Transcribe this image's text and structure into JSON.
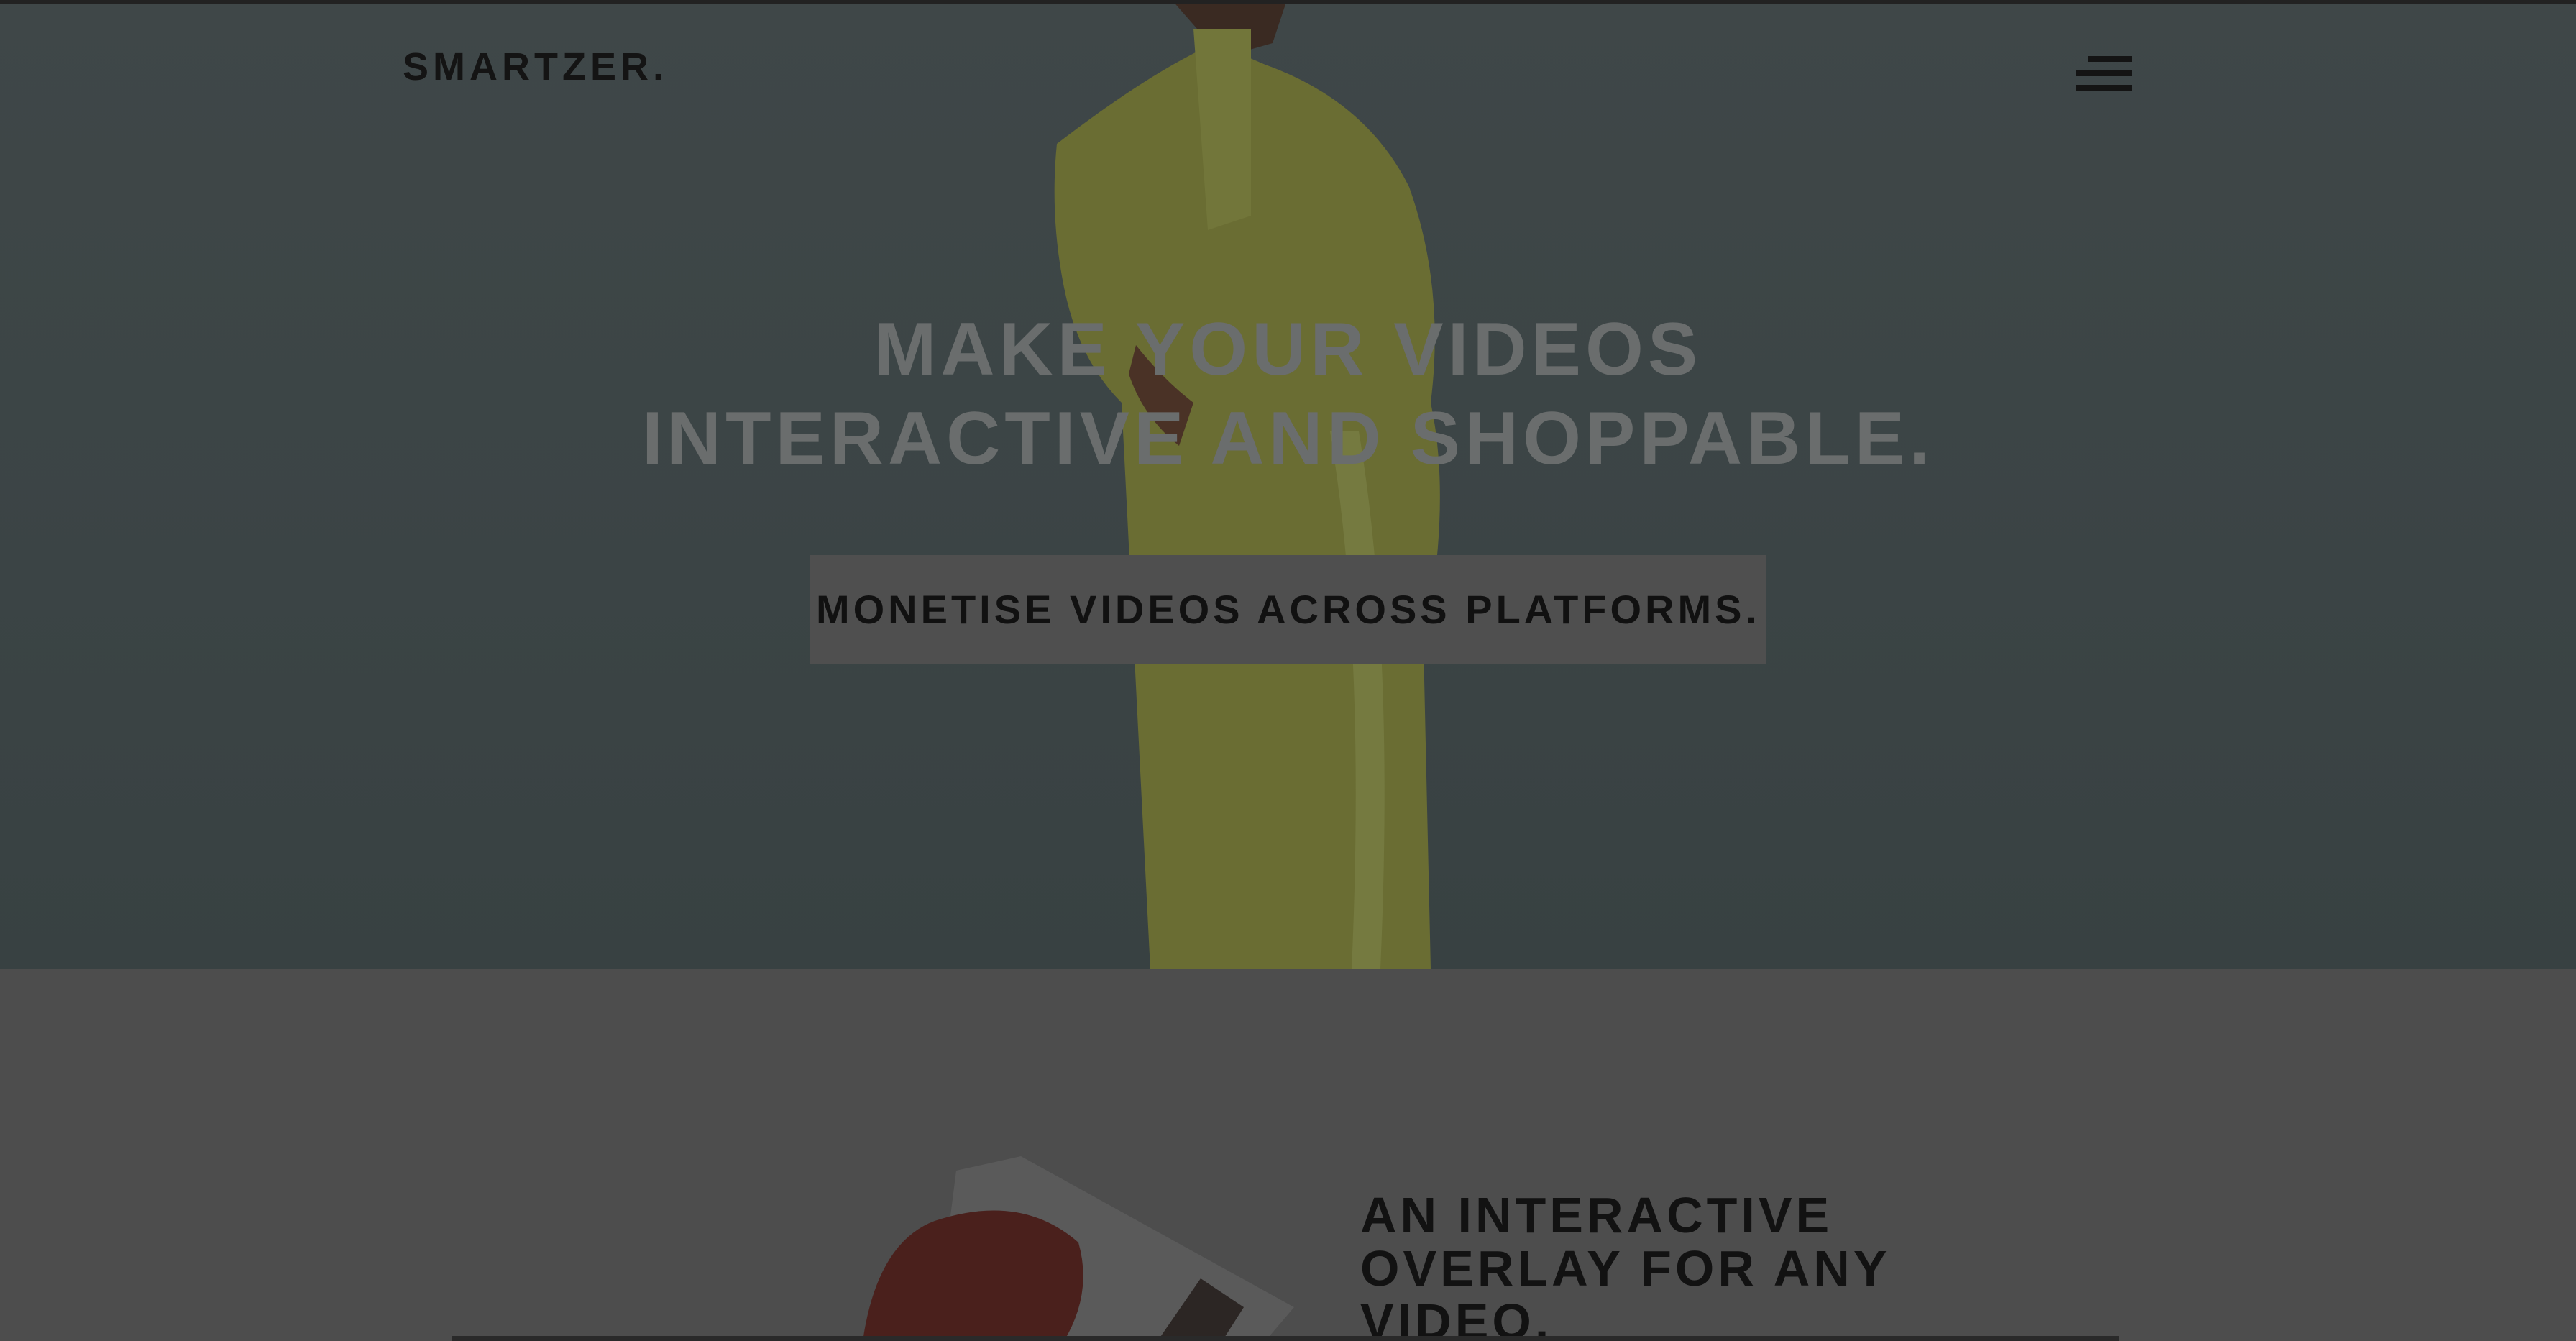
{
  "header": {
    "logo": "SMARTZER.",
    "menu_icon": "hamburger-icon"
  },
  "hero": {
    "headline_line1": "MAKE YOUR VIDEOS",
    "headline_line2": "INTERACTIVE AND SHOPPABLE.",
    "cta_label": "MONETISE VIDEOS ACROSS PLATFORMS."
  },
  "feature": {
    "heading_line1": "AN INTERACTIVE",
    "heading_line2": "OVERLAY FOR ANY",
    "heading_line3": "VIDEO."
  }
}
